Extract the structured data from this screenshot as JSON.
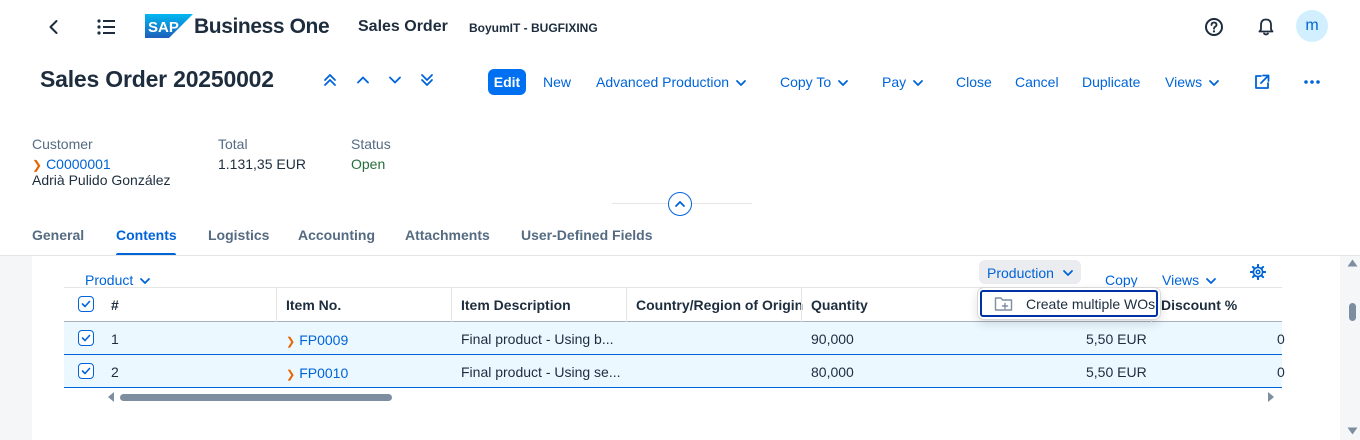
{
  "shell": {
    "brand": "Business One",
    "logo_text": "SAP",
    "app_title": "Sales Order",
    "company": "BoyumIT - BUGFIXING",
    "avatar": "m"
  },
  "header": {
    "title": "Sales Order 20250002",
    "actions": {
      "edit": "Edit",
      "new": "New",
      "advanced_production": "Advanced Production",
      "copy_to": "Copy To",
      "pay": "Pay",
      "close": "Close",
      "cancel": "Cancel",
      "duplicate": "Duplicate",
      "views": "Views"
    }
  },
  "attributes": {
    "customer_label": "Customer",
    "customer_code": "C0000001",
    "customer_name": "Adrià Pulido González",
    "total_label": "Total",
    "total_value": "1.131,35 EUR",
    "status_label": "Status",
    "status_value": "Open"
  },
  "tabs": [
    "General",
    "Contents",
    "Logistics",
    "Accounting",
    "Attachments",
    "User-Defined Fields"
  ],
  "toolbar": {
    "product": "Product",
    "production": "Production",
    "copy": "Copy",
    "views": "Views"
  },
  "table": {
    "columns": [
      "#",
      "Item No.",
      "Item Description",
      "Country/Region of Origin",
      "Quantity",
      "Discount %"
    ],
    "rows": [
      {
        "num": "1",
        "item_no": "FP0009",
        "description": "Final product - Using b...",
        "country": "",
        "quantity": "90,000",
        "price": "5,50 EUR",
        "discount": "0"
      },
      {
        "num": "2",
        "item_no": "FP0010",
        "description": "Final product - Using se...",
        "country": "",
        "quantity": "80,000",
        "price": "5,50 EUR",
        "discount": "0"
      }
    ]
  },
  "popover": {
    "item": "Create multiple WOs"
  },
  "colors": {
    "accent": "#0064d9",
    "emphasized_button": "#0070f2",
    "status_positive": "#256f3a",
    "link_arrow": "#e76500",
    "selected_row": "#ebf8ff"
  }
}
